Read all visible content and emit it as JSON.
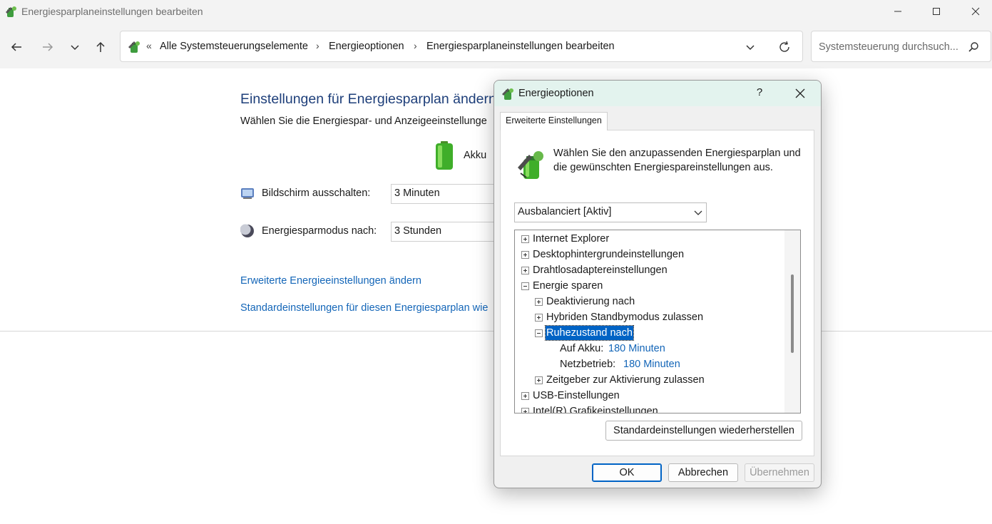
{
  "window": {
    "title": "Energiesparplaneinstellungen bearbeiten"
  },
  "nav": {
    "back_icon": "arrow-left-icon",
    "forward_icon": "arrow-right-icon",
    "recent_icon": "chevron-down-icon",
    "up_icon": "arrow-up-icon"
  },
  "address": {
    "overflow": "«",
    "crumbs": [
      "Alle Systemsteuerungselemente",
      "Energieoptionen",
      "Energiesparplaneinstellungen bearbeiten"
    ],
    "separator": "›"
  },
  "search": {
    "placeholder": "Systemsteuerung durchsuch..."
  },
  "main": {
    "heading": "Einstellungen für Energiesparplan ändern",
    "subheading": "Wählen Sie die Energiespar- und Anzeigeeinstellunge",
    "column_label": "Akku",
    "display_off_label": "Bildschirm ausschalten:",
    "display_off_value": "3 Minuten",
    "sleep_label": "Energiesparmodus nach:",
    "sleep_value": "3 Stunden",
    "link_advanced": "Erweiterte Energieeinstellungen ändern",
    "link_defaults": "Standardeinstellungen für diesen Energiesparplan wie"
  },
  "dialog": {
    "title": "Energieoptionen",
    "help": "?",
    "tab": "Erweiterte Einstellungen",
    "description": "Wählen Sie den anzupassenden Energiesparplan und die gewünschten Energiespareinstellungen aus.",
    "plan": "Ausbalanciert [Aktiv]",
    "tree": {
      "internet_explorer": "Internet Explorer",
      "desktop_bg": "Desktophintergrundeinstellungen",
      "wireless": "Drahtlosadaptereinstellungen",
      "energy_saving": "Energie sparen",
      "deactivate_after": "Deaktivierung nach",
      "hybrid_standby": "Hybriden Standbymodus zulassen",
      "hibernate_after": "Ruhezustand nach",
      "on_battery_label": "Auf Akku:",
      "on_battery_value": "180 Minuten",
      "plugged_in_label": "Netzbetrieb:",
      "plugged_in_value": "180 Minuten",
      "wake_timers": "Zeitgeber zur Aktivierung zulassen",
      "usb": "USB-Einstellungen",
      "intel_graphics": "Intel(R) Grafikeinstellungen"
    },
    "restore_button": "Standardeinstellungen wiederherstellen",
    "ok_button": "OK",
    "cancel_button": "Abbrechen",
    "apply_button": "Übernehmen"
  }
}
